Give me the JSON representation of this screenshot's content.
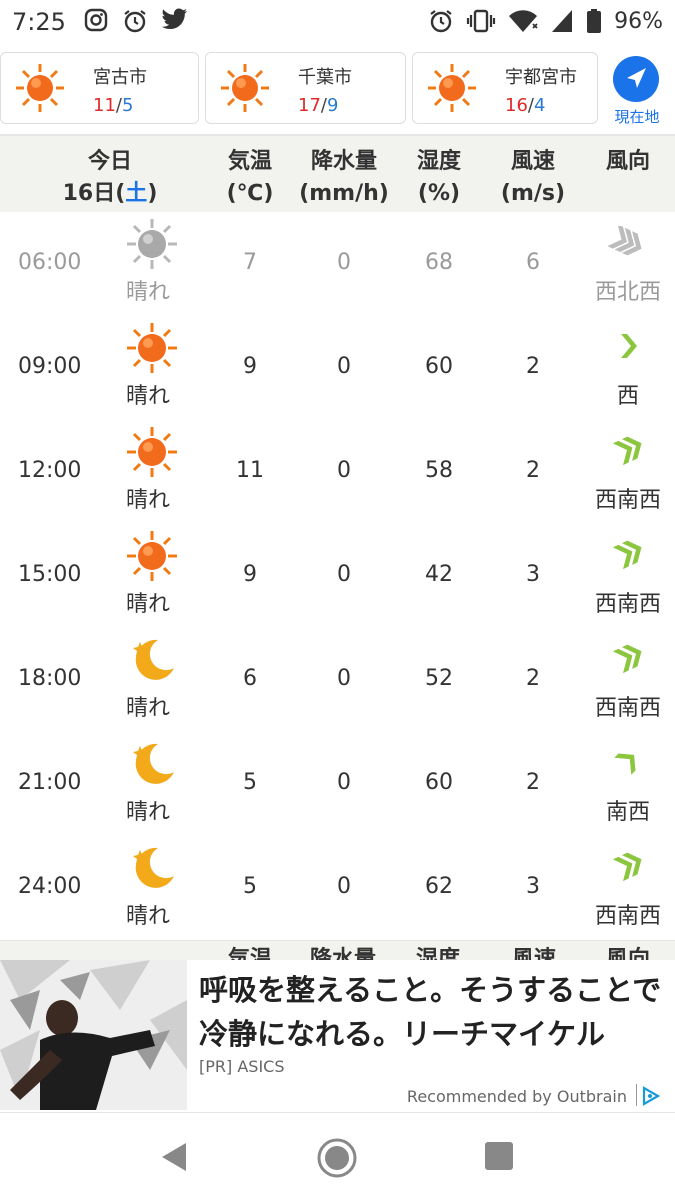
{
  "status": {
    "time": "7:25",
    "battery": "96%"
  },
  "cities": [
    {
      "name": "宮古市",
      "hi": "11",
      "lo": "5"
    },
    {
      "name": "千葉市",
      "hi": "17",
      "lo": "9"
    },
    {
      "name": "宇都宮市",
      "hi": "16",
      "lo": "4"
    }
  ],
  "locate_label": "現在地",
  "header": {
    "today": "今日",
    "date": "16日",
    "weekday": "土",
    "temp": "気温",
    "temp_unit": "(℃)",
    "precip": "降水量",
    "precip_unit": "(mm/h)",
    "humidity": "湿度",
    "humidity_unit": "(%)",
    "wind_speed": "風速",
    "wind_speed_unit": "(m/s)",
    "wind_dir": "風向"
  },
  "rows": [
    {
      "time": "06:00",
      "weather": "晴れ",
      "icon": "sun-gray",
      "temp": "7",
      "precip": "0",
      "humidity": "68",
      "wind": "6",
      "dir": "西北西",
      "past": true
    },
    {
      "time": "09:00",
      "weather": "晴れ",
      "icon": "sun",
      "temp": "9",
      "precip": "0",
      "humidity": "60",
      "wind": "2",
      "dir": "西",
      "past": false
    },
    {
      "time": "12:00",
      "weather": "晴れ",
      "icon": "sun",
      "temp": "11",
      "precip": "0",
      "humidity": "58",
      "wind": "2",
      "dir": "西南西",
      "past": false
    },
    {
      "time": "15:00",
      "weather": "晴れ",
      "icon": "sun",
      "temp": "9",
      "precip": "0",
      "humidity": "42",
      "wind": "3",
      "dir": "西南西",
      "past": false
    },
    {
      "time": "18:00",
      "weather": "晴れ",
      "icon": "moon",
      "temp": "6",
      "precip": "0",
      "humidity": "52",
      "wind": "2",
      "dir": "西南西",
      "past": false
    },
    {
      "time": "21:00",
      "weather": "晴れ",
      "icon": "moon",
      "temp": "5",
      "precip": "0",
      "humidity": "60",
      "wind": "2",
      "dir": "南西",
      "past": false
    },
    {
      "time": "24:00",
      "weather": "晴れ",
      "icon": "moon",
      "temp": "5",
      "precip": "0",
      "humidity": "62",
      "wind": "3",
      "dir": "西南西",
      "past": false
    }
  ],
  "ad": {
    "headline": "呼吸を整えること。そうすることで冷静になれる。リーチマイケル",
    "sponsor": "[PR]  ASICS",
    "recommended": "Recommended by Outbrain"
  },
  "colors": {
    "accent": "#1a73e8",
    "hi_temp": "#e02a2a",
    "lo_temp": "#2a7ad5",
    "arrow_green": "#8cc63f",
    "header_bg": "#f2f2ee"
  }
}
